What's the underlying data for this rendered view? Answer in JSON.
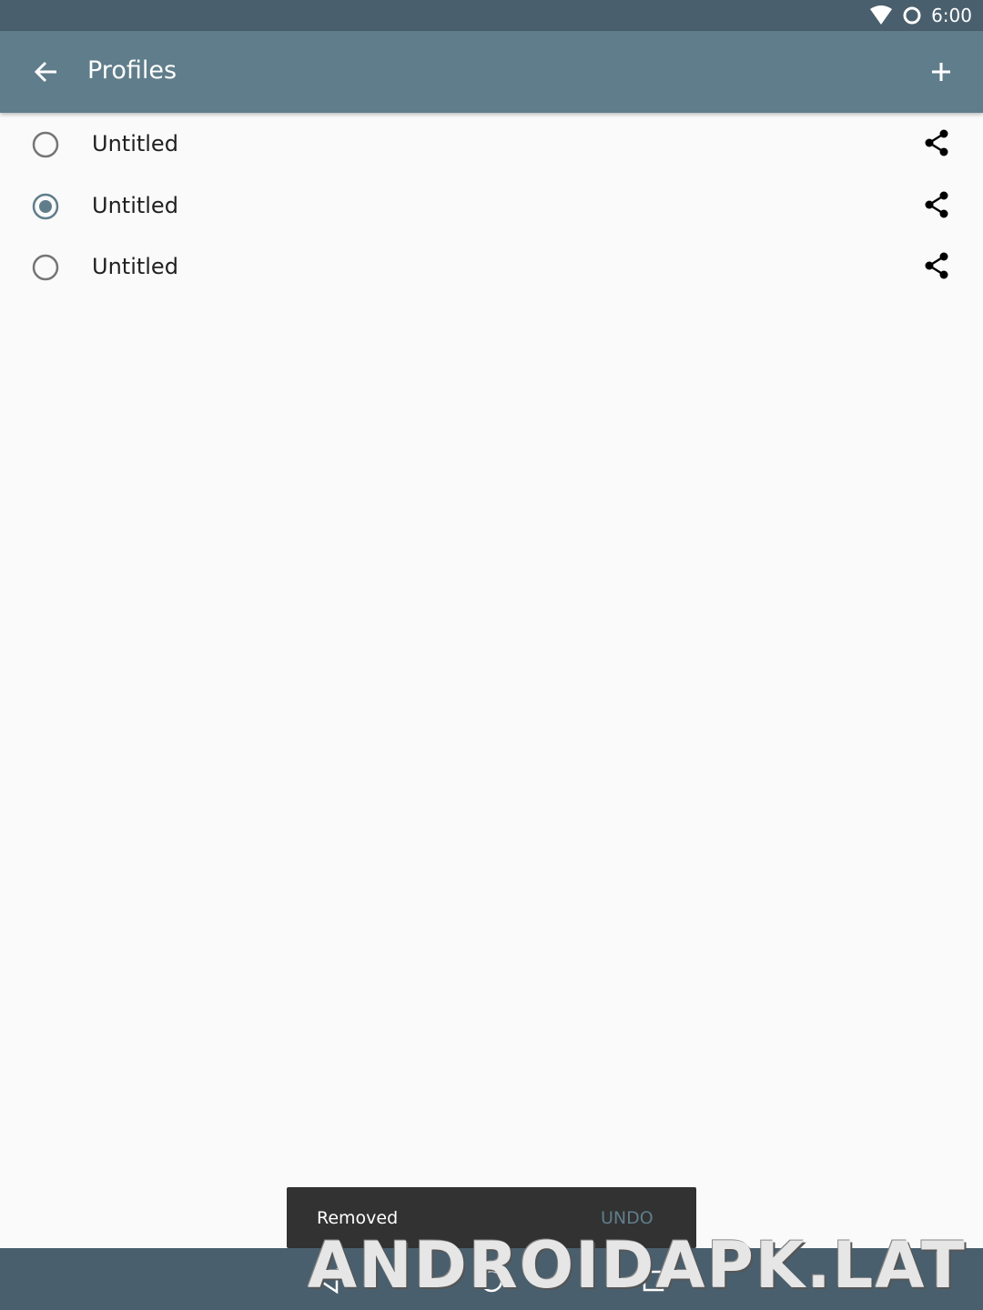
{
  "status_bar": {
    "time": "6:00",
    "icons": [
      "wifi-icon",
      "ring-icon"
    ]
  },
  "app_bar": {
    "title": "Profiles",
    "back_icon": "arrow-left-icon",
    "add_icon": "plus-icon"
  },
  "profiles": [
    {
      "name": "Untitled",
      "selected": false
    },
    {
      "name": "Untitled",
      "selected": true
    },
    {
      "name": "Untitled",
      "selected": false
    }
  ],
  "snackbar": {
    "message": "Removed",
    "action": "UNDO"
  },
  "watermark": "ANDROIDAPK.LAT",
  "colors": {
    "primary": "#607d8b",
    "primary_dark": "#4a5f6d",
    "background": "#fafafa",
    "snackbar": "#323232"
  }
}
